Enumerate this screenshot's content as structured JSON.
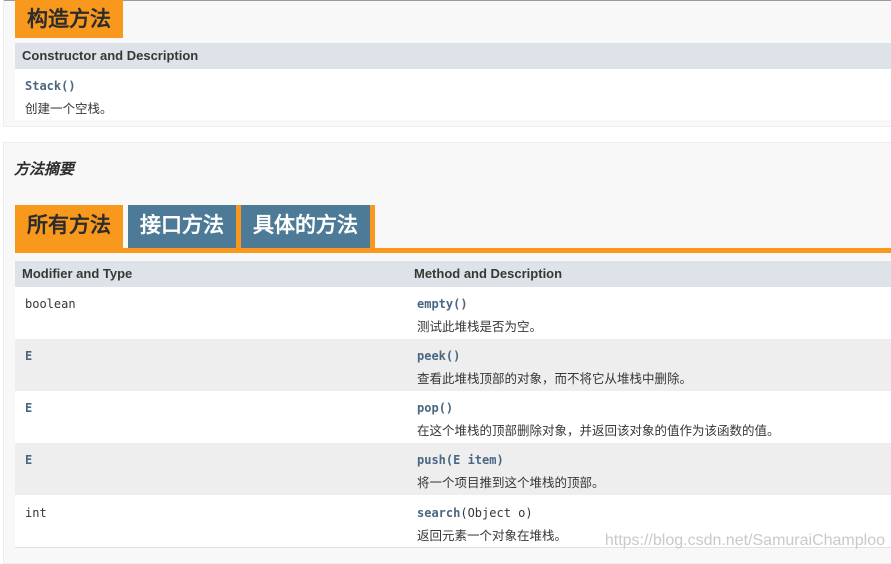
{
  "constructor_section": {
    "tab_label": "构造方法",
    "header": "Constructor and Description",
    "rows": [
      {
        "name": "Stack",
        "params": "()",
        "desc": "创建一个空栈。"
      }
    ]
  },
  "method_summary": {
    "title": "方法摘要",
    "tabs": [
      {
        "label": "所有方法",
        "active": true
      },
      {
        "label": "接口方法",
        "active": false
      },
      {
        "label": "具体的方法",
        "active": false
      }
    ],
    "headers": {
      "type": "Modifier and Type",
      "method": "Method and Description"
    },
    "rows": [
      {
        "type": "boolean",
        "type_link": false,
        "name": "empty",
        "params": "()",
        "desc": "测试此堆栈是否为空。"
      },
      {
        "type": "E",
        "type_link": true,
        "name": "peek",
        "params": "()",
        "desc": "查看此堆栈顶部的对象，而不将它从堆栈中删除。"
      },
      {
        "type": "E",
        "type_link": true,
        "name": "pop",
        "params": "()",
        "desc": "在这个堆栈的顶部删除对象，并返回该对象的值作为该函数的值。"
      },
      {
        "type": "E",
        "type_link": true,
        "name": "push",
        "params": "(E item)",
        "desc": "将一个项目推到这个堆栈的顶部。"
      },
      {
        "type": "int",
        "type_link": false,
        "name": "search",
        "params": "(Object o)",
        "desc": "返回元素一个对象在堆栈。"
      }
    ]
  },
  "watermark": "https://blog.csdn.net/SamuraiChamploo"
}
